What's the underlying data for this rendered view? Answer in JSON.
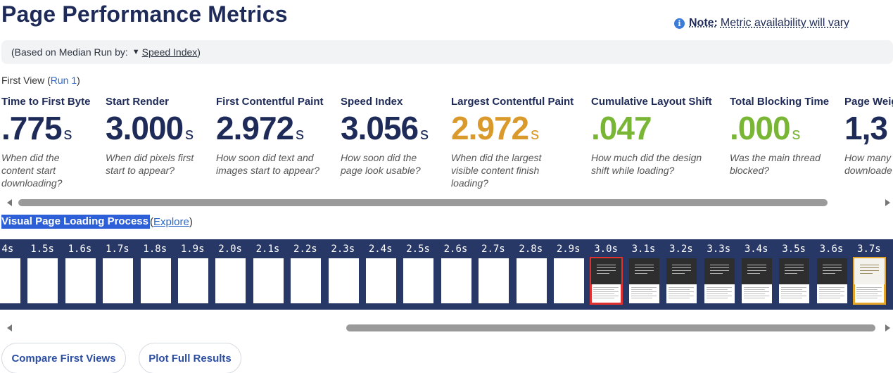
{
  "page": {
    "title": "Page Performance Metrics",
    "note_label": "Note:",
    "note_text": "Metric availability will vary",
    "note_icon": "info-icon",
    "accent": "#2d5fd8"
  },
  "median": {
    "prefix": "(Based on Median Run by:",
    "link": "Speed Index",
    "suffix": ")"
  },
  "first_view": {
    "label": "First View (",
    "run_link": "Run 1",
    "suffix": ")"
  },
  "metrics": [
    {
      "label": "Time to First Byte",
      "value": ".775",
      "unit": "s",
      "desc": "When did the content start downloading?",
      "color": "#1e2b59"
    },
    {
      "label": "Start Render",
      "value": "3.000",
      "unit": "s",
      "desc": "When did pixels first start to appear?",
      "color": "#1e2b59"
    },
    {
      "label": "First Contentful Paint",
      "value": "2.972",
      "unit": "s",
      "desc": "How soon did text and images start to appear?",
      "color": "#1e2b59"
    },
    {
      "label": "Speed Index",
      "value": "3.056",
      "unit": "s",
      "desc": "How soon did the page look usable?",
      "color": "#1e2b59"
    },
    {
      "label": "Largest Contentful Paint",
      "value": "2.972",
      "unit": "s",
      "desc": "When did the largest visible content finish loading?",
      "color": "#d99a2b"
    },
    {
      "label": "Cumulative Layout Shift",
      "value": ".047",
      "unit": "",
      "desc": "How much did the design shift while loading?",
      "color": "#7ab636"
    },
    {
      "label": "Total Blocking Time",
      "value": ".000",
      "unit": "s",
      "desc": "Was the main thread blocked?",
      "color": "#7ab636"
    },
    {
      "label": "Page Weig",
      "value": "1,3",
      "unit": "",
      "desc": "How many downloade",
      "color": "#1e2b59"
    }
  ],
  "visual": {
    "title": "Visual Page Loading Process",
    "paren_open": "(",
    "explore": "Explore",
    "paren_close": ")"
  },
  "filmstrip": [
    {
      "time": ".4s",
      "state": "blank"
    },
    {
      "time": "1.5s",
      "state": "blank"
    },
    {
      "time": "1.6s",
      "state": "blank"
    },
    {
      "time": "1.7s",
      "state": "blank"
    },
    {
      "time": "1.8s",
      "state": "blank"
    },
    {
      "time": "1.9s",
      "state": "blank"
    },
    {
      "time": "2.0s",
      "state": "blank"
    },
    {
      "time": "2.1s",
      "state": "blank"
    },
    {
      "time": "2.2s",
      "state": "blank"
    },
    {
      "time": "2.3s",
      "state": "blank"
    },
    {
      "time": "2.4s",
      "state": "blank"
    },
    {
      "time": "2.5s",
      "state": "blank"
    },
    {
      "time": "2.6s",
      "state": "blank"
    },
    {
      "time": "2.7s",
      "state": "blank"
    },
    {
      "time": "2.8s",
      "state": "blank"
    },
    {
      "time": "2.9s",
      "state": "blank"
    },
    {
      "time": "3.0s",
      "state": "content",
      "highlight": "red"
    },
    {
      "time": "3.1s",
      "state": "content"
    },
    {
      "time": "3.2s",
      "state": "content"
    },
    {
      "time": "3.3s",
      "state": "content"
    },
    {
      "time": "3.4s",
      "state": "content"
    },
    {
      "time": "3.5s",
      "state": "content"
    },
    {
      "time": "3.6s",
      "state": "content"
    },
    {
      "time": "3.7s",
      "state": "content-light",
      "highlight": "gold"
    }
  ],
  "buttons": {
    "compare": "Compare First Views",
    "plot": "Plot Full Results"
  }
}
